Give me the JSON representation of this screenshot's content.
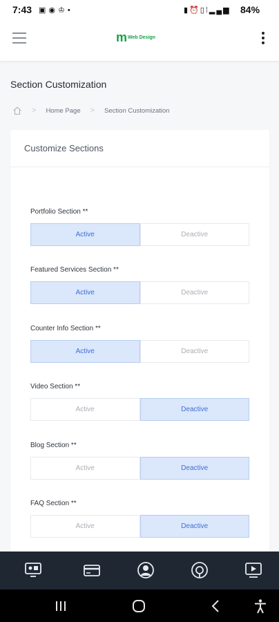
{
  "status_bar": {
    "time": "7:43",
    "left_icons": [
      "gallery-icon",
      "pinterest-icon",
      "shirt-icon",
      "dot-icon"
    ],
    "right_icons": [
      "battery-saver-icon",
      "alarm-icon",
      "vibrate-icon",
      "wifi-call-icon",
      "signal-icon"
    ],
    "battery": "84%"
  },
  "header": {
    "logo_text": "Web Design",
    "menu_icon": "hamburger-icon",
    "more_icon": "kebab-icon"
  },
  "page": {
    "title": "Section Customization",
    "breadcrumb": [
      "Home Page",
      "Section Customization"
    ]
  },
  "card": {
    "title": "Customize Sections",
    "sections": [
      {
        "label": "Portfolio Section **",
        "active_label": "Active",
        "deactive_label": "Deactive",
        "selected": "Active"
      },
      {
        "label": "Featured Services Section **",
        "active_label": "Active",
        "deactive_label": "Deactive",
        "selected": "Active"
      },
      {
        "label": "Counter Info Section **",
        "active_label": "Active",
        "deactive_label": "Deactive",
        "selected": "Active"
      },
      {
        "label": "Video Section **",
        "active_label": "Active",
        "deactive_label": "Deactive",
        "selected": "Deactive"
      },
      {
        "label": "Blog Section **",
        "active_label": "Active",
        "deactive_label": "Deactive",
        "selected": "Deactive"
      },
      {
        "label": "FAQ Section **",
        "active_label": "Active",
        "deactive_label": "Deactive",
        "selected": "Deactive"
      }
    ]
  },
  "bottom_nav": [
    "dashboard-icon",
    "payment-card-icon",
    "profile-icon",
    "support-icon",
    "video-icon"
  ],
  "colors": {
    "selected_bg": "#dbe7fb",
    "selected_text": "#3f6fd1",
    "nav_bg": "#1f2733",
    "brand": "#1aa04a"
  }
}
